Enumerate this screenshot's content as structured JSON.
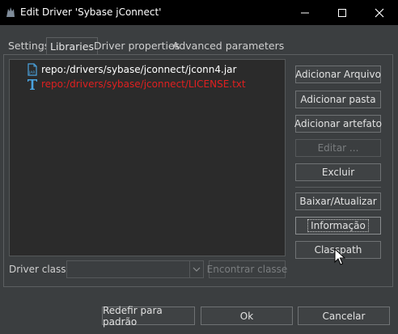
{
  "window": {
    "title": "Edit Driver 'Sybase jConnect'",
    "controls": {
      "minimize": "minimize-icon",
      "maximize": "maximize-icon",
      "close": "close-icon"
    }
  },
  "tabs": [
    {
      "label": "Settings",
      "active": false
    },
    {
      "label": "Libraries",
      "active": true
    },
    {
      "label": "Driver properties",
      "active": false
    },
    {
      "label": "Advanced parameters",
      "active": false
    }
  ],
  "libraries": [
    {
      "path": "repo:/drivers/sybase/jconnect/jconn4.jar",
      "icon": "jar-file-icon",
      "color": "#ffffff"
    },
    {
      "path": "repo:/drivers/sybase/jconnect/LICENSE.txt",
      "icon": "text-file-icon",
      "color": "#e02020"
    }
  ],
  "side_buttons": {
    "add_file": "Adicionar Arquivo",
    "add_folder": "Adicionar pasta",
    "add_artifact": "Adicionar artefato",
    "edit": "Editar ...",
    "delete": "Excluir",
    "download_update": "Baixar/Atualizar",
    "information": "Informação",
    "classpath": "Classpath"
  },
  "driver_class": {
    "label": "Driver class:",
    "value": "",
    "find_button": "Encontrar classe"
  },
  "footer": {
    "reset": "Redefir para padrão",
    "ok": "Ok",
    "cancel": "Cancelar"
  },
  "colors": {
    "titlebar": "#000000",
    "background": "#3b3e40",
    "list_background": "#2b2b2b",
    "icon_blue": "#4aa3df",
    "error_red": "#e02020"
  }
}
